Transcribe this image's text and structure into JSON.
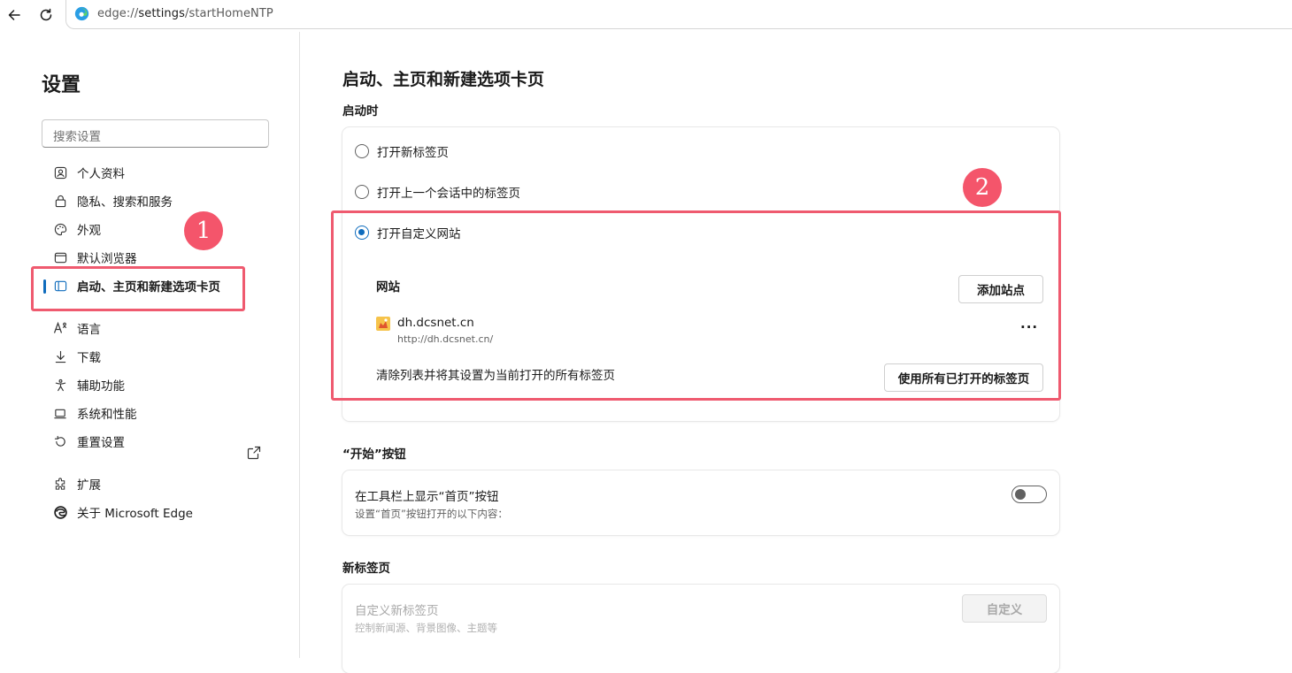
{
  "browser": {
    "url_prefix": "edge://",
    "url_host": "settings",
    "url_path": "/startHomeNTP"
  },
  "sidebar": {
    "title": "设置",
    "search_placeholder": "搜索设置",
    "items": [
      {
        "label": "个人资料",
        "icon": "profile-icon"
      },
      {
        "label": "隐私、搜索和服务",
        "icon": "lock-icon"
      },
      {
        "label": "外观",
        "icon": "palette-icon"
      },
      {
        "label": "默认浏览器",
        "icon": "browser-icon"
      },
      {
        "label": "启动、主页和新建选项卡页",
        "icon": "home-tab-icon",
        "active": true
      },
      {
        "label": "语言",
        "icon": "language-icon"
      },
      {
        "label": "下载",
        "icon": "download-icon"
      },
      {
        "label": "辅助功能",
        "icon": "accessibility-icon"
      },
      {
        "label": "系统和性能",
        "icon": "laptop-icon"
      },
      {
        "label": "重置设置",
        "icon": "reset-icon"
      },
      {
        "label": "扩展",
        "icon": "puzzle-icon"
      },
      {
        "label": "关于 Microsoft Edge",
        "icon": "edge-logo-icon"
      }
    ]
  },
  "annotations": {
    "marker1": "1",
    "marker2": "2",
    "color": "#ef5a6f"
  },
  "main": {
    "title": "启动、主页和新建选项卡页",
    "startup": {
      "label": "启动时",
      "options": [
        {
          "label": "打开新标签页",
          "checked": false
        },
        {
          "label": "打开上一个会话中的标签页",
          "checked": false
        },
        {
          "label": "打开自定义网站",
          "checked": true
        }
      ],
      "sites_title": "网站",
      "add_site_button": "添加站点",
      "sites": [
        {
          "name": "dh.dcsnet.cn",
          "url": "http://dh.dcsnet.cn/"
        }
      ],
      "more_button": "···",
      "clear_text": "清除列表并将其设置为当前打开的所有标签页",
      "use_open_tabs_button": "使用所有已打开的标签页"
    },
    "home_button": {
      "label": "“开始”按钮",
      "title": "在工具栏上显示“首页”按钮",
      "description": "设置“首页”按钮打开的以下内容：",
      "toggle_on": false
    },
    "new_tab": {
      "label": "新标签页",
      "title": "自定义新标签页",
      "description": "控制新闻源、背景图像、主题等",
      "customize_button": "自定义"
    }
  },
  "colors": {
    "accent": "#0f6cbd",
    "annotation": "#ef5a6f"
  }
}
